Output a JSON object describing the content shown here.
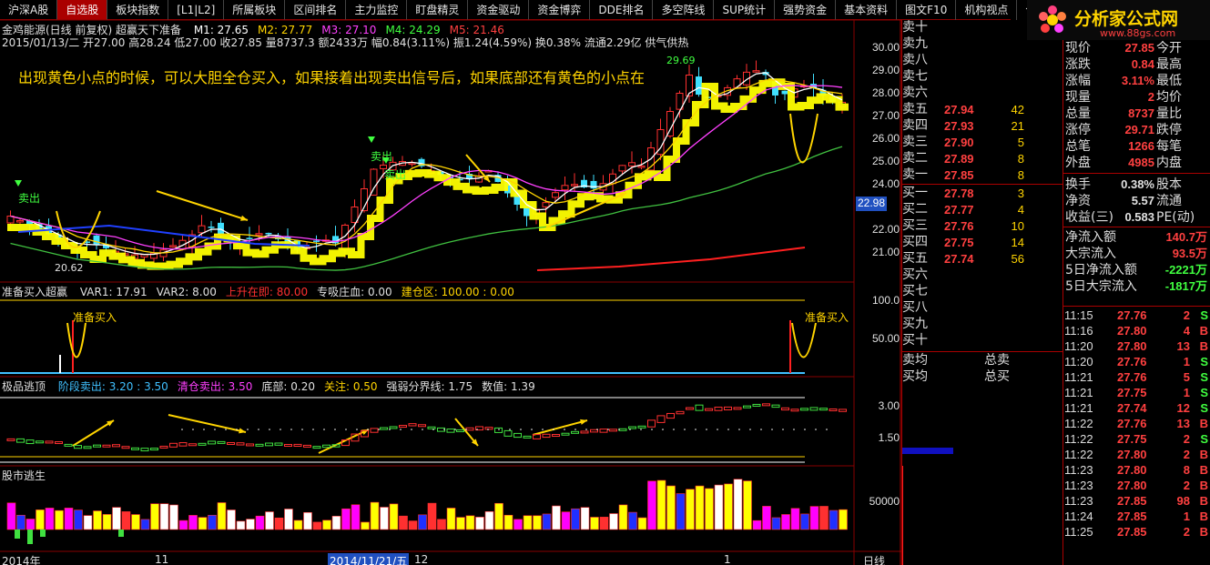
{
  "tabs": [
    "沪深A股",
    "自选股",
    "板块指数",
    "[L1|L2]",
    "所属板块",
    "区间排名",
    "主力监控",
    "盯盘精灵",
    "资金驱动",
    "资金博弈",
    "DDE排名",
    "多空阵线",
    "SUP统计",
    "强势资金",
    "基本资料",
    "图文F10",
    "机构视点",
    "今日信息"
  ],
  "active_tab": 1,
  "logo": {
    "name": "分析家公式网",
    "url": "www.88gs.com"
  },
  "header": {
    "stock": "金鸡能源(日线 前复权) 超赢天下准备",
    "ma": [
      {
        "label": "M1: 27.65",
        "color": "#ffffff"
      },
      {
        "label": "M2: 27.77",
        "color": "#ffd400"
      },
      {
        "label": "M3: 27.10",
        "color": "#ff40ff"
      },
      {
        "label": "M4: 24.29",
        "color": "#40ff40"
      },
      {
        "label": "M5: 21.46",
        "color": "#ff4040"
      }
    ],
    "info": "2015/01/13/二  开27.00 高28.24 低27.00 收27.85 量8737.3 额2433万 幅0.84(3.11%) 振1.24(4.59%) 换0.38% 流通2.29亿 供气供热"
  },
  "annotation": "出现黄色小点的时候，可以大胆全仓买入，如果接着出现卖出信号后，如果底部还有黄色的小点在",
  "chart_labels": {
    "sell1": "卖出",
    "sell2": "卖出",
    "sell3": "卖出",
    "high_label": "29.69",
    "low_label": "20.62",
    "current_price": "22.98"
  },
  "price_axis": [
    "30.00",
    "29.00",
    "28.00",
    "27.00",
    "26.00",
    "25.00",
    "24.00",
    "22.00",
    "21.00"
  ],
  "panel2": {
    "title": "准备买入超赢",
    "items": [
      {
        "label": "VAR1: 17.91",
        "color": "#e0e0e0"
      },
      {
        "label": "VAR2: 8.00",
        "color": "#e0e0e0"
      },
      {
        "label": "上升在即: 80.00",
        "color": "#ff3030"
      },
      {
        "label": "专吸庄血: 0.00",
        "color": "#e0e0e0"
      },
      {
        "label": "建仓区: 100.00 : 0.00",
        "color": "#ffd400"
      }
    ],
    "axis": [
      "100.0",
      "50.00"
    ],
    "label_left": "准备买入",
    "label_right": "准备买入"
  },
  "panel3": {
    "title": "极品逃顶",
    "items": [
      {
        "label": "阶段卖出: 3.20 : 3.50",
        "color": "#40c0ff"
      },
      {
        "label": "清仓卖出: 3.50",
        "color": "#ff40ff"
      },
      {
        "label": "底部: 0.20",
        "color": "#e0e0e0"
      },
      {
        "label": "关注: 0.50",
        "color": "#ffd400"
      },
      {
        "label": "强弱分界线: 1.75",
        "color": "#e0e0e0"
      },
      {
        "label": "数值: 1.39",
        "color": "#e0e0e0"
      }
    ],
    "axis": [
      "3.00",
      "1.50"
    ]
  },
  "panel4": {
    "title": "股市逃生",
    "axis": [
      "50000"
    ]
  },
  "xaxis": {
    "labels": [
      "2014年",
      "11",
      "2014/11/21/五",
      "12",
      "1"
    ],
    "right_label": "日线"
  },
  "orders": {
    "asks": [
      {
        "label": "卖十",
        "price": "",
        "vol": ""
      },
      {
        "label": "卖九",
        "price": "",
        "vol": ""
      },
      {
        "label": "卖八",
        "price": "",
        "vol": ""
      },
      {
        "label": "卖七",
        "price": "",
        "vol": ""
      },
      {
        "label": "卖六",
        "price": "",
        "vol": ""
      },
      {
        "label": "卖五",
        "price": "27.94",
        "vol": "42"
      },
      {
        "label": "卖四",
        "price": "27.93",
        "vol": "21"
      },
      {
        "label": "卖三",
        "price": "27.90",
        "vol": "5"
      },
      {
        "label": "卖二",
        "price": "27.89",
        "vol": "8"
      },
      {
        "label": "卖一",
        "price": "27.85",
        "vol": "8"
      }
    ],
    "bids": [
      {
        "label": "买一",
        "price": "27.78",
        "vol": "3"
      },
      {
        "label": "买二",
        "price": "27.77",
        "vol": "4"
      },
      {
        "label": "买三",
        "price": "27.76",
        "vol": "10"
      },
      {
        "label": "买四",
        "price": "27.75",
        "vol": "14"
      },
      {
        "label": "买五",
        "price": "27.74",
        "vol": "56"
      },
      {
        "label": "买六",
        "price": "",
        "vol": ""
      },
      {
        "label": "买七",
        "price": "",
        "vol": ""
      },
      {
        "label": "买八",
        "price": "",
        "vol": ""
      },
      {
        "label": "买九",
        "price": "",
        "vol": ""
      },
      {
        "label": "买十",
        "price": "",
        "vol": ""
      }
    ],
    "avg_sell": "卖均",
    "total_sell": "总卖",
    "avg_buy": "买均",
    "total_buy": "总买"
  },
  "stats": [
    {
      "k1": "现价",
      "v1": "27.85",
      "k2": "今开"
    },
    {
      "k1": "涨跌",
      "v1": "0.84",
      "k2": "最高"
    },
    {
      "k1": "涨幅",
      "v1": "3.11%",
      "k2": "最低"
    },
    {
      "k1": "现量",
      "v1": "2",
      "k2": "均价"
    },
    {
      "k1": "总量",
      "v1": "8737",
      "k2": "量比"
    },
    {
      "k1": "涨停",
      "v1": "29.71",
      "k2": "跌停"
    },
    {
      "k1": "总笔",
      "v1": "1266",
      "k2": "每笔"
    },
    {
      "k1": "外盘",
      "v1": "4985",
      "k2": "内盘"
    }
  ],
  "stats2": [
    {
      "k1": "换手",
      "v1": "0.38%",
      "k2": "股本"
    },
    {
      "k1": "净资",
      "v1": "5.57",
      "k2": "流通"
    },
    {
      "k1": "收益(三)",
      "v1": "0.583",
      "k2": "PE(动)"
    }
  ],
  "flows": [
    {
      "k": "净流入额",
      "v": "140.7万"
    },
    {
      "k": "大宗流入",
      "v": "93.5万"
    },
    {
      "k": "5日净流入额",
      "v": "-2221万"
    },
    {
      "k": "5日大宗流入",
      "v": "-1817万"
    }
  ],
  "ticks": [
    {
      "t": "11:15",
      "p": "27.76",
      "v": "2",
      "f": "S"
    },
    {
      "t": "11:16",
      "p": "27.80",
      "v": "4",
      "f": "B"
    },
    {
      "t": "11:20",
      "p": "27.80",
      "v": "13",
      "f": "B"
    },
    {
      "t": "11:20",
      "p": "27.76",
      "v": "1",
      "f": "S"
    },
    {
      "t": "11:21",
      "p": "27.76",
      "v": "5",
      "f": "S"
    },
    {
      "t": "11:21",
      "p": "27.75",
      "v": "1",
      "f": "S"
    },
    {
      "t": "11:21",
      "p": "27.74",
      "v": "12",
      "f": "S"
    },
    {
      "t": "11:22",
      "p": "27.76",
      "v": "13",
      "f": "B"
    },
    {
      "t": "11:22",
      "p": "27.75",
      "v": "2",
      "f": "S"
    },
    {
      "t": "11:22",
      "p": "27.80",
      "v": "2",
      "f": "B"
    },
    {
      "t": "11:23",
      "p": "27.80",
      "v": "8",
      "f": "B"
    },
    {
      "t": "11:23",
      "p": "27.80",
      "v": "2",
      "f": "B"
    },
    {
      "t": "11:23",
      "p": "27.85",
      "v": "98",
      "f": "B"
    },
    {
      "t": "11:24",
      "p": "27.85",
      "v": "1",
      "f": "B"
    },
    {
      "t": "11:25",
      "p": "27.85",
      "v": "2",
      "f": "B"
    }
  ]
}
